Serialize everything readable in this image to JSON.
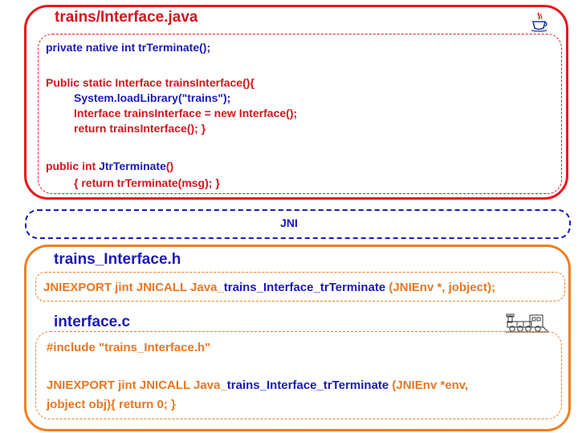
{
  "java": {
    "title": "trains/Interface.java",
    "lines": {
      "l1": "private native int trTerminate();",
      "l2": "Public static Interface trainsInterface(){",
      "l3": "System.loadLibrary(\"trains\");",
      "l4": "Interface trainsInterface = new Interface();",
      "l5": "return trainsInterface(); }",
      "l6a": "public int ",
      "l6b": "JtrTerminate",
      "l6c": "()",
      "l7": "{ return trTerminate(msg); }"
    },
    "icon": "java-coffee-cup-icon"
  },
  "jni": {
    "label": "JNI"
  },
  "header_file": {
    "title": "trains_Interface.h",
    "line_a": "JNIEXPORT jint JNICALL Java_",
    "line_b": "trains_Interface_trTerminate",
    "line_c": " (JNIEnv *, jobject);"
  },
  "c_file": {
    "title": "interface.c",
    "include": "#include \"trains_Interface.h\"",
    "line_a": "JNIEXPORT jint JNICALL Java_",
    "line_b": "trains_Interface_trTerminate",
    "line_c": " (JNIEnv *env,",
    "line_d": "jobject obj){ return 0; }",
    "icon": "train-locomotive-icon"
  },
  "colors": {
    "java_red": "#e8151b",
    "jni_blue": "#1a1ab8",
    "native_orange": "#ef7f1e"
  }
}
